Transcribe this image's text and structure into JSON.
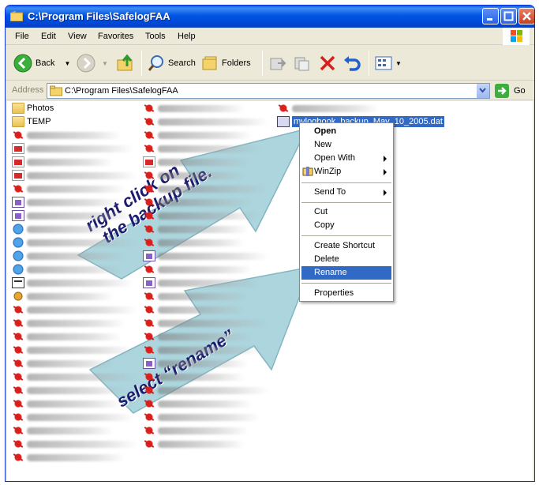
{
  "window": {
    "title": "C:\\Program Files\\SafelogFAA"
  },
  "menubar": {
    "items": [
      "File",
      "Edit",
      "View",
      "Favorites",
      "Tools",
      "Help"
    ]
  },
  "toolbar": {
    "back_label": "Back",
    "search_label": "Search",
    "folders_label": "Folders"
  },
  "address": {
    "label": "Address",
    "value": "C:\\Program Files\\SafelogFAA",
    "go_label": "Go"
  },
  "files": {
    "folders": [
      "Photos",
      "TEMP"
    ],
    "selected_file": "mylogbook_backup_May_10_2005.dat"
  },
  "context_menu": {
    "open": "Open",
    "new": "New",
    "open_with": "Open With",
    "winzip": "WinZip",
    "send_to": "Send To",
    "cut": "Cut",
    "copy": "Copy",
    "create_shortcut": "Create Shortcut",
    "delete": "Delete",
    "rename": "Rename",
    "properties": "Properties"
  },
  "callouts": {
    "first_line1": "right click on",
    "first_line2": "the backup file.",
    "second": "select “rename”"
  },
  "colors": {
    "title_blue": "#0055e5",
    "selection": "#316ac5",
    "arrow_fill": "#a9d4dc",
    "callout_text": "#1c1c6e"
  }
}
